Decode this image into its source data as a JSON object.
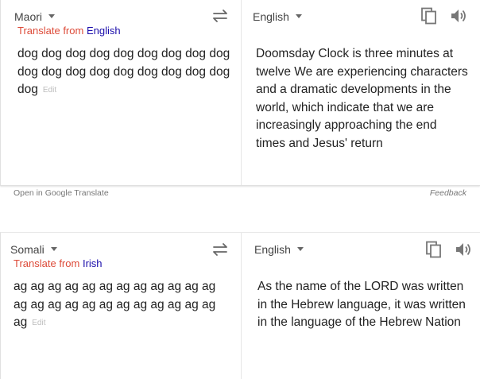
{
  "panel1": {
    "source_lang": "Maori",
    "translate_from_prefix": "Translate from",
    "translate_from_lang": "English",
    "source_text_line1": "dog dog dog dog dog dog dog dog dog",
    "source_text_line2": "dog dog dog dog dog dog dog dog dog",
    "source_text_line3": "dog",
    "edit_label": "Edit",
    "target_lang": "English",
    "translation_lines": [
      "Doomsday Clock is three minutes at",
      "twelve We are experiencing characters",
      "and a dramatic developments in the",
      "world, which indicate that we are",
      "increasingly approaching the end",
      "times and Jesus' return"
    ]
  },
  "footer": {
    "open_label": "Open in Google Translate",
    "feedback_label": "Feedback"
  },
  "panel2": {
    "source_lang": "Somali",
    "translate_from_prefix": "Translate from",
    "translate_from_lang": "Irish",
    "source_text_line1": "ag ag ag ag ag ag ag ag ag ag ag ag",
    "source_text_line2": "ag ag ag ag ag ag ag ag ag ag ag ag",
    "source_text_line3": "ag",
    "edit_label": "Edit",
    "target_lang": "English",
    "translation_lines": [
      "As the name of the LORD was written",
      "in the Hebrew language, it was written",
      "in the language of the Hebrew Nation"
    ]
  },
  "icons": {
    "swap": "swap-arrows-icon",
    "copy": "copy-icon",
    "speaker": "speaker-icon"
  },
  "colors": {
    "translate_from": "#dd4b39",
    "from_lang_link": "#1a0dab",
    "muted": "#777777"
  }
}
